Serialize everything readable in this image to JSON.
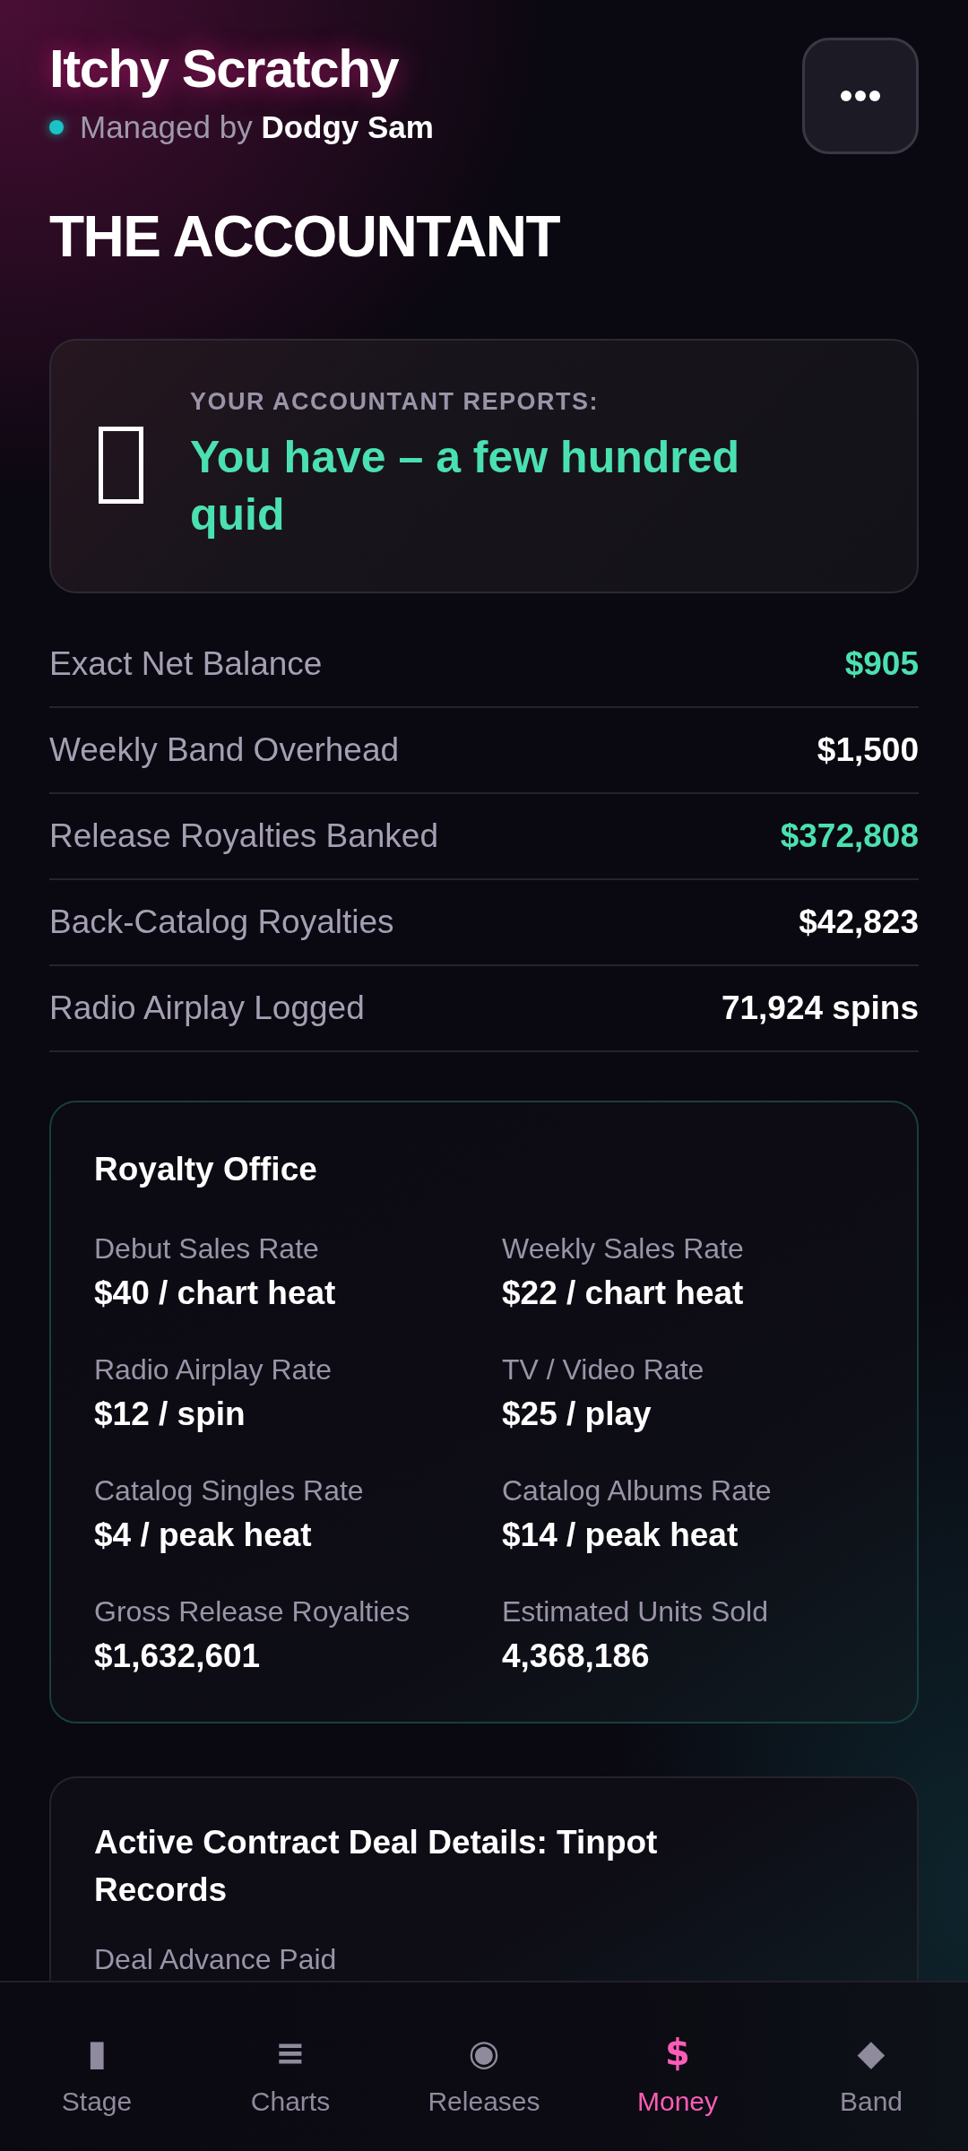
{
  "header": {
    "band_name": "Itchy Scratchy",
    "manager": "Managed by **Dodgy Sam**",
    "title": "THE ACCOUNTANT"
  },
  "report": {
    "label": "YOUR ACCOUNTANT REPORTS:",
    "verdict": "You have – a few hundred quid"
  },
  "summary_rows": [
    {
      "label": "Exact Net Balance",
      "value": "$905",
      "highlighted": true
    },
    {
      "label": "Weekly Band Overhead",
      "value": "$1,500",
      "highlighted": false
    },
    {
      "label": "Release Royalties Banked",
      "value": "$372,808",
      "highlighted": true
    },
    {
      "label": "Back-Catalog Royalties",
      "value": "$42,823",
      "highlighted": false
    },
    {
      "label": "Radio Airplay Logged",
      "value": "71,924 spins",
      "highlighted": false
    }
  ],
  "royalty_office": {
    "title": "Royalty Office",
    "stats": [
      {
        "label": "Debut Sales Rate",
        "value": "$40 / chart heat"
      },
      {
        "label": "Weekly Sales Rate",
        "value": "$22 / chart heat"
      },
      {
        "label": "Radio Airplay Rate",
        "value": "$12 / spin"
      },
      {
        "label": "TV / Video Rate",
        "value": "$25 / play"
      },
      {
        "label": "Catalog Singles Rate",
        "value": "$4 / peak heat"
      },
      {
        "label": "Catalog Albums Rate",
        "value": "$14 / peak heat"
      },
      {
        "label": "Gross Release Royalties",
        "value": "$1,632,601"
      },
      {
        "label": "Estimated Units Sold",
        "value": "4,368,186"
      }
    ]
  },
  "contract": {
    "title": "Active Contract Deal Details: Tinpot Records",
    "fields": [
      {
        "label": "Deal Advance Paid"
      }
    ]
  },
  "nav": [
    {
      "icon": "▮",
      "label": "Stage",
      "selected": false
    },
    {
      "icon": "≡",
      "label": "Charts",
      "selected": false
    },
    {
      "icon": "◉",
      "label": "Releases",
      "selected": false
    },
    {
      "icon": "$",
      "label": "Money",
      "selected": true
    },
    {
      "icon": "◆",
      "label": "Band",
      "selected": false
    }
  ]
}
